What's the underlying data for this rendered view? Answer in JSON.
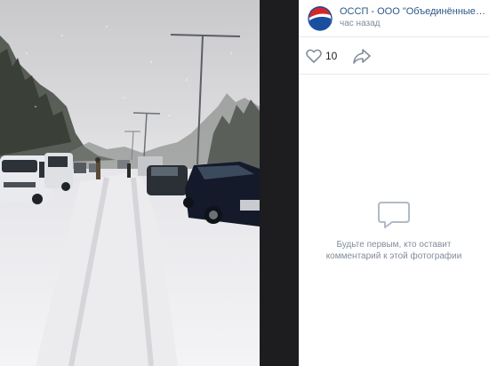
{
  "post": {
    "owner_name": "ОССП - ООО \"Объединённые систе...",
    "time": "час назад",
    "avatar_icon": "pepsi-logo-icon",
    "avatar_colors": {
      "red": "#d7262a",
      "blue": "#1a4fa0",
      "white": "#ffffff"
    }
  },
  "actions": {
    "like_icon": "heart-outline-icon",
    "like_count": "10",
    "share_icon": "share-arrow-icon"
  },
  "comments": {
    "empty_icon": "comment-bubble-icon",
    "empty_line1": "Будьте первым, кто оставит",
    "empty_line2": "комментарий к этой фотографии"
  },
  "colors": {
    "link": "#2a5885",
    "secondary_text": "#818c99",
    "gutter": "#1d1d1f",
    "divider": "#e7e8ec"
  },
  "photo": {
    "subject": "snowy-highway-traffic-jam"
  }
}
